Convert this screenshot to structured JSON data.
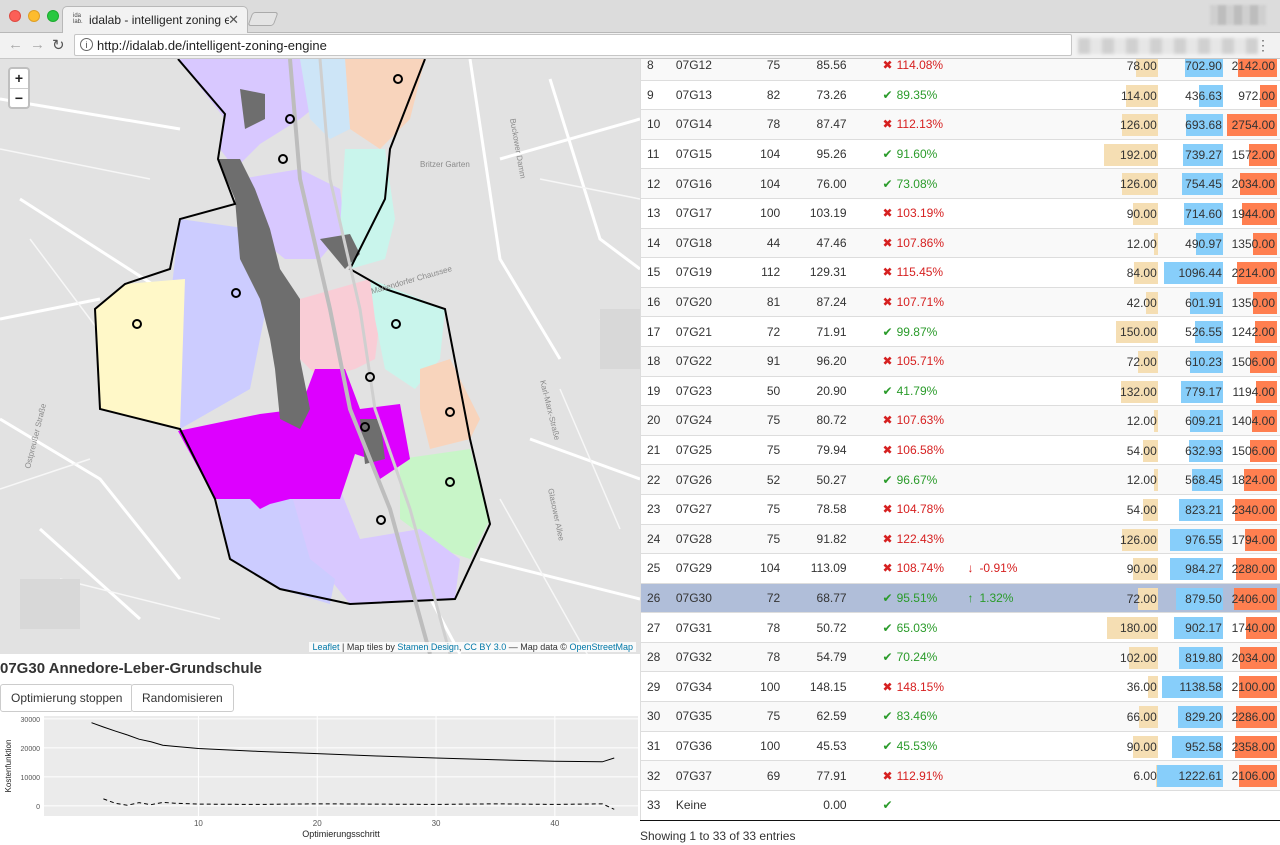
{
  "browser": {
    "tab_title": "idalab - intelligent zoning engine",
    "favicon_text": "ida lab.",
    "url": "http://idalab.de/intelligent-zoning-engine"
  },
  "map": {
    "zoom_in": "+",
    "zoom_out": "−",
    "attribution": {
      "leaflet": "Leaflet",
      "sep1": " | Map tiles by ",
      "stamen": "Stamen Design",
      "sep2": ", ",
      "cc": "CC BY 3.0",
      "sep3": " — Map data © ",
      "osm": "OpenStreetMap"
    },
    "street_labels": [
      "Britzer Garten",
      "Mariendorfer Chaussee",
      "Karl-Marx-Straße",
      "Buckower Damm",
      "Glasower Allee",
      "Ostpreußer Straße"
    ],
    "colors": {
      "magenta": "#dd00ff",
      "gray": "#6e6e6e",
      "lavender": "#ccccff",
      "light_violet": "#d8c8ff",
      "pink": "#f9cdd6",
      "mint": "#c9f5ec",
      "peach": "#f8d4bc",
      "light_yellow": "#fff8c8",
      "light_green": "#c8f5c8",
      "light_blue": "#cde5f7"
    }
  },
  "school": {
    "title": "07G30 Annedore-Leber-Grundschule",
    "stop_button": "Optimierung stoppen",
    "randomize_button": "Randomisieren"
  },
  "chart_data": {
    "type": "line",
    "xlabel": "Optimierungsschritt",
    "ylabel": "Kostenfunktion",
    "x_ticks": [
      10,
      20,
      30,
      40
    ],
    "y_ticks": [
      "0",
      "10000",
      "20000",
      "30000"
    ],
    "xlim": [
      -3,
      47
    ],
    "ylim": [
      -3500,
      31000
    ],
    "series": [
      {
        "style": "solid",
        "x": [
          1,
          2,
          3,
          4,
          5,
          6,
          7,
          8,
          10,
          15,
          20,
          25,
          30,
          35,
          40,
          44,
          45
        ],
        "y": [
          28700,
          27200,
          25800,
          24500,
          23000,
          22100,
          20900,
          20500,
          19800,
          18800,
          18000,
          17200,
          16500,
          15900,
          15400,
          15200,
          16500
        ]
      },
      {
        "style": "dashed",
        "x": [
          2,
          3,
          4,
          5,
          6,
          7,
          8,
          10,
          15,
          20,
          25,
          30,
          35,
          40,
          44,
          45
        ],
        "y": [
          2400,
          900,
          200,
          1100,
          400,
          1200,
          900,
          600,
          500,
          700,
          600,
          500,
          700,
          500,
          700,
          -1200
        ]
      }
    ]
  },
  "table": {
    "rows": [
      {
        "id": "8",
        "code": "07G12",
        "s": "75",
        "f": "85.56",
        "ok": false,
        "pct": "114.08%",
        "chg": "",
        "chg_dir": "",
        "a": "78.00",
        "b": "702.90",
        "c": "2142.00"
      },
      {
        "id": "9",
        "code": "07G13",
        "s": "82",
        "f": "73.26",
        "ok": true,
        "pct": "89.35%",
        "chg": "",
        "chg_dir": "",
        "a": "114.00",
        "b": "436.63",
        "c": "972.00"
      },
      {
        "id": "10",
        "code": "07G14",
        "s": "78",
        "f": "87.47",
        "ok": false,
        "pct": "112.13%",
        "chg": "",
        "chg_dir": "",
        "a": "126.00",
        "b": "693.68",
        "c": "2754.00"
      },
      {
        "id": "11",
        "code": "07G15",
        "s": "104",
        "f": "95.26",
        "ok": true,
        "pct": "91.60%",
        "chg": "",
        "chg_dir": "",
        "a": "192.00",
        "b": "739.27",
        "c": "1572.00"
      },
      {
        "id": "12",
        "code": "07G16",
        "s": "104",
        "f": "76.00",
        "ok": true,
        "pct": "73.08%",
        "chg": "",
        "chg_dir": "",
        "a": "126.00",
        "b": "754.45",
        "c": "2034.00"
      },
      {
        "id": "13",
        "code": "07G17",
        "s": "100",
        "f": "103.19",
        "ok": false,
        "pct": "103.19%",
        "chg": "",
        "chg_dir": "",
        "a": "90.00",
        "b": "714.60",
        "c": "1944.00"
      },
      {
        "id": "14",
        "code": "07G18",
        "s": "44",
        "f": "47.46",
        "ok": false,
        "pct": "107.86%",
        "chg": "",
        "chg_dir": "",
        "a": "12.00",
        "b": "490.97",
        "c": "1350.00"
      },
      {
        "id": "15",
        "code": "07G19",
        "s": "112",
        "f": "129.31",
        "ok": false,
        "pct": "115.45%",
        "chg": "",
        "chg_dir": "",
        "a": "84.00",
        "b": "1096.44",
        "c": "2214.00"
      },
      {
        "id": "16",
        "code": "07G20",
        "s": "81",
        "f": "87.24",
        "ok": false,
        "pct": "107.71%",
        "chg": "",
        "chg_dir": "",
        "a": "42.00",
        "b": "601.91",
        "c": "1350.00"
      },
      {
        "id": "17",
        "code": "07G21",
        "s": "72",
        "f": "71.91",
        "ok": true,
        "pct": "99.87%",
        "chg": "",
        "chg_dir": "",
        "a": "150.00",
        "b": "526.55",
        "c": "1242.00"
      },
      {
        "id": "18",
        "code": "07G22",
        "s": "91",
        "f": "96.20",
        "ok": false,
        "pct": "105.71%",
        "chg": "",
        "chg_dir": "",
        "a": "72.00",
        "b": "610.23",
        "c": "1506.00"
      },
      {
        "id": "19",
        "code": "07G23",
        "s": "50",
        "f": "20.90",
        "ok": true,
        "pct": "41.79%",
        "chg": "",
        "chg_dir": "",
        "a": "132.00",
        "b": "779.17",
        "c": "1194.00"
      },
      {
        "id": "20",
        "code": "07G24",
        "s": "75",
        "f": "80.72",
        "ok": false,
        "pct": "107.63%",
        "chg": "",
        "chg_dir": "",
        "a": "12.00",
        "b": "609.21",
        "c": "1404.00"
      },
      {
        "id": "21",
        "code": "07G25",
        "s": "75",
        "f": "79.94",
        "ok": false,
        "pct": "106.58%",
        "chg": "",
        "chg_dir": "",
        "a": "54.00",
        "b": "632.93",
        "c": "1506.00"
      },
      {
        "id": "22",
        "code": "07G26",
        "s": "52",
        "f": "50.27",
        "ok": true,
        "pct": "96.67%",
        "chg": "",
        "chg_dir": "",
        "a": "12.00",
        "b": "568.45",
        "c": "1824.00"
      },
      {
        "id": "23",
        "code": "07G27",
        "s": "75",
        "f": "78.58",
        "ok": false,
        "pct": "104.78%",
        "chg": "",
        "chg_dir": "",
        "a": "54.00",
        "b": "823.21",
        "c": "2340.00"
      },
      {
        "id": "24",
        "code": "07G28",
        "s": "75",
        "f": "91.82",
        "ok": false,
        "pct": "122.43%",
        "chg": "",
        "chg_dir": "",
        "a": "126.00",
        "b": "976.55",
        "c": "1794.00"
      },
      {
        "id": "25",
        "code": "07G29",
        "s": "104",
        "f": "113.09",
        "ok": false,
        "pct": "108.74%",
        "chg": "-0.91%",
        "chg_dir": "down",
        "a": "90.00",
        "b": "984.27",
        "c": "2280.00"
      },
      {
        "id": "26",
        "code": "07G30",
        "s": "72",
        "f": "68.77",
        "ok": true,
        "pct": "95.51%",
        "chg": "1.32%",
        "chg_dir": "up",
        "a": "72.00",
        "b": "879.50",
        "c": "2406.00",
        "selected": true
      },
      {
        "id": "27",
        "code": "07G31",
        "s": "78",
        "f": "50.72",
        "ok": true,
        "pct": "65.03%",
        "chg": "",
        "chg_dir": "",
        "a": "180.00",
        "b": "902.17",
        "c": "1740.00"
      },
      {
        "id": "28",
        "code": "07G32",
        "s": "78",
        "f": "54.79",
        "ok": true,
        "pct": "70.24%",
        "chg": "",
        "chg_dir": "",
        "a": "102.00",
        "b": "819.80",
        "c": "2034.00"
      },
      {
        "id": "29",
        "code": "07G34",
        "s": "100",
        "f": "148.15",
        "ok": false,
        "pct": "148.15%",
        "chg": "",
        "chg_dir": "",
        "a": "36.00",
        "b": "1138.58",
        "c": "2100.00"
      },
      {
        "id": "30",
        "code": "07G35",
        "s": "75",
        "f": "62.59",
        "ok": true,
        "pct": "83.46%",
        "chg": "",
        "chg_dir": "",
        "a": "66.00",
        "b": "829.20",
        "c": "2286.00"
      },
      {
        "id": "31",
        "code": "07G36",
        "s": "100",
        "f": "45.53",
        "ok": true,
        "pct": "45.53%",
        "chg": "",
        "chg_dir": "",
        "a": "90.00",
        "b": "952.58",
        "c": "2358.00"
      },
      {
        "id": "32",
        "code": "07G37",
        "s": "69",
        "f": "77.91",
        "ok": false,
        "pct": "112.91%",
        "chg": "",
        "chg_dir": "",
        "a": "6.00",
        "b": "1222.61",
        "c": "2106.00"
      },
      {
        "id": "33",
        "code": "Keine",
        "s": "",
        "f": "0.00",
        "ok": true,
        "pct": "",
        "chg": "",
        "chg_dir": "",
        "a": "",
        "b": "",
        "c": ""
      }
    ],
    "bar_colors": {
      "a": "#f5deb3",
      "b": "#87cefa",
      "c": "#ff7f50"
    },
    "bar_max": {
      "a": 200,
      "b": 1300,
      "c": 3000
    },
    "info": "Showing 1 to 33 of 33 entries"
  }
}
